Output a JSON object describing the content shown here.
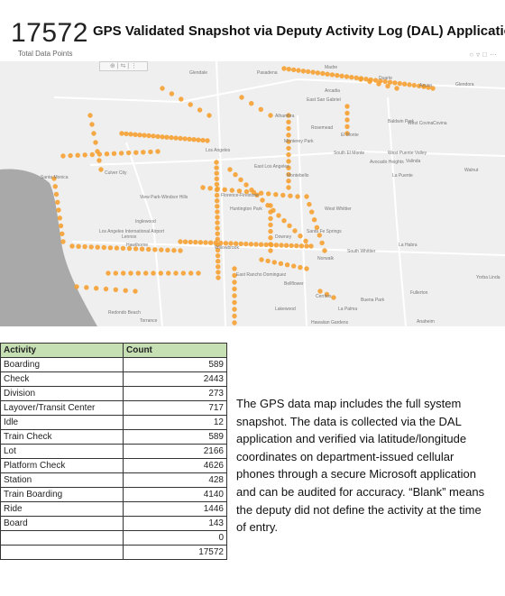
{
  "header": {
    "total_value": "17572",
    "total_caption": "Total Data Points",
    "title": "GPS Validated Snapshot via Deputy Activity Log (DAL) Application",
    "icons": [
      "pin-icon",
      "filter-icon",
      "focus-icon",
      "more-icon"
    ]
  },
  "map": {
    "places": [
      "Glendale",
      "Pasadena",
      "Arcadia",
      "Duarte",
      "Azusa",
      "Glendora",
      "Madre",
      "East San Gabriel",
      "Alhambra",
      "Baldwin Park",
      "West Covina",
      "Covina",
      "Rosemead",
      "El Monte",
      "Monterey Park",
      "South El Monte",
      "Los Angeles",
      "East Los Angeles",
      "Montebello",
      "Avocado Heights",
      "Valinda",
      "West Puente Valley",
      "La Puente",
      "Walnut",
      "Culver City",
      "Santa Monica",
      "View Park-Windsor Hills",
      "Florence-Firestone",
      "Huntington Park",
      "Inglewood",
      "Los Angeles International Airport",
      "Lennox",
      "Hawthorne",
      "Willowbrook",
      "West Whittier",
      "Santa Fe Springs",
      "Downey",
      "South Whittier",
      "Norwalk",
      "La Habra",
      "Yorba Linda",
      "Bellflower",
      "East Rancho Dominguez",
      "Fullerton",
      "Cerritos",
      "Buena Park",
      "Redondo Beach",
      "Torrance",
      "Lakewood",
      "La Palma",
      "Anaheim",
      "Hawaiian Gardens"
    ]
  },
  "table": {
    "headers": [
      "Activity",
      "Count"
    ],
    "rows": [
      {
        "activity": "Boarding",
        "count": "589"
      },
      {
        "activity": "Check",
        "count": "2443"
      },
      {
        "activity": "Division",
        "count": "273"
      },
      {
        "activity": "Layover/Transit Center",
        "count": "717"
      },
      {
        "activity": "Idle",
        "count": "12"
      },
      {
        "activity": "Train Check",
        "count": "589"
      },
      {
        "activity": "Lot",
        "count": "2166"
      },
      {
        "activity": "Platform Check",
        "count": "4626"
      },
      {
        "activity": "Station",
        "count": "428"
      },
      {
        "activity": "Train Boarding",
        "count": "4140"
      },
      {
        "activity": "Ride",
        "count": "1446"
      },
      {
        "activity": "Board",
        "count": "143"
      },
      {
        "activity": "",
        "count": "0"
      },
      {
        "activity": "",
        "count": "17572"
      }
    ]
  },
  "description": {
    "lines": [
      "The GPS data map includes the full system",
      "snapshot. The data is collected via the DAL",
      "application and verified via latitude/longitude",
      "coordinates on department-issued cellular",
      "phones through a secure Microsoft application",
      "and can be audited for accuracy. “Blank” means",
      "the deputy did not define the activity at the time",
      "of entry."
    ]
  },
  "colors": {
    "dot": "#f5a031",
    "header_fill": "#c6e0b4",
    "ocean": "#a9a9a9",
    "land": "#efefef"
  }
}
